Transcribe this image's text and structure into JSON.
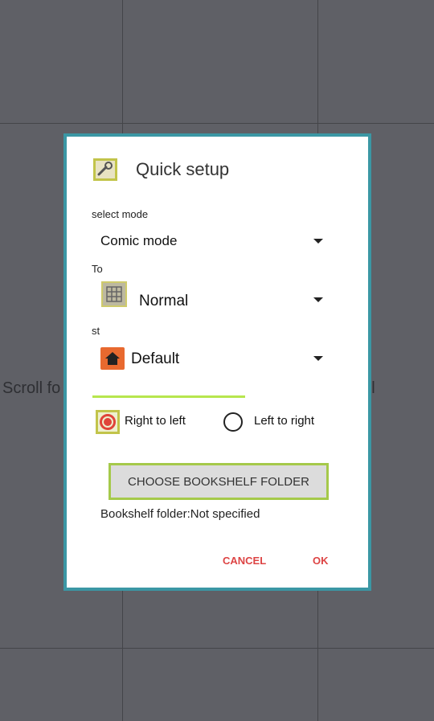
{
  "background": {
    "left_text": "Scroll fo",
    "right_text": "roll"
  },
  "modal": {
    "title": "Quick setup",
    "select_mode_label": "select mode",
    "combo_mode": "Comic mode",
    "tool_label": "To",
    "layout_value": "Normal",
    "style_label": "st",
    "theme_value": "Default",
    "radio_rtl_label": "Right to left",
    "radio_ltr_label": "Left to right",
    "choose_button_label": "CHOOSE BOOKSHELF FOLDER",
    "bookshelf_folder_text": "Bookshelf folder:Not specified",
    "cancel_label": "CANCEL",
    "ok_label": "OK"
  },
  "icons": [
    "wrench-icon",
    "grid-icon",
    "home-icon",
    "dropdown-arrow-icon"
  ],
  "colors": {
    "modal_border": "#3b97a4",
    "action_text": "#dd4444",
    "radio_selected": "#e0443a",
    "background": "#5f6066"
  }
}
